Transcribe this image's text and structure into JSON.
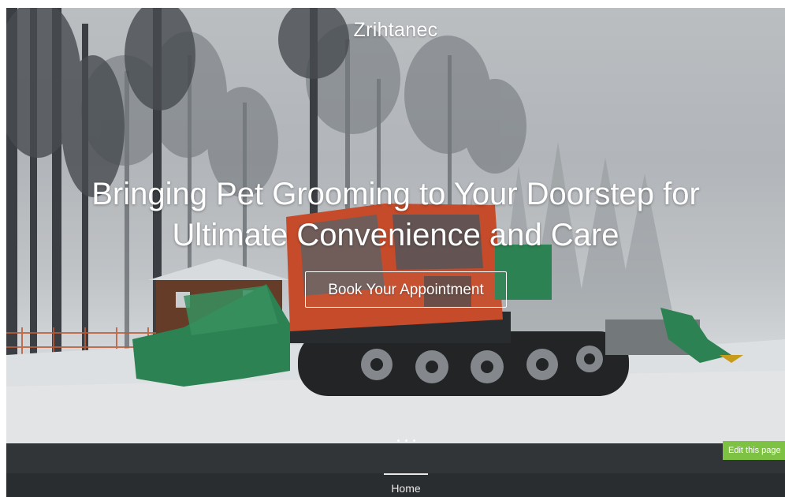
{
  "site": {
    "title": "Zrihtanec"
  },
  "hero": {
    "headline_line1": "Bringing Pet Grooming to Your Doorstep for",
    "headline_line2": "Ultimate Convenience and Care",
    "cta_label": "Book Your Appointment",
    "image_subject": "snow-groomer-vehicle-in-winter-forest"
  },
  "nav": {
    "items": [
      {
        "label": "Home",
        "active": true
      }
    ]
  },
  "editor": {
    "edit_label": "Edit this page"
  },
  "colors": {
    "nav_background": "#2a2d30",
    "band_background": "#323538",
    "edit_button": "#7dc242",
    "groomer_cab": "#d4502c",
    "groomer_blade": "#2e8b57"
  }
}
